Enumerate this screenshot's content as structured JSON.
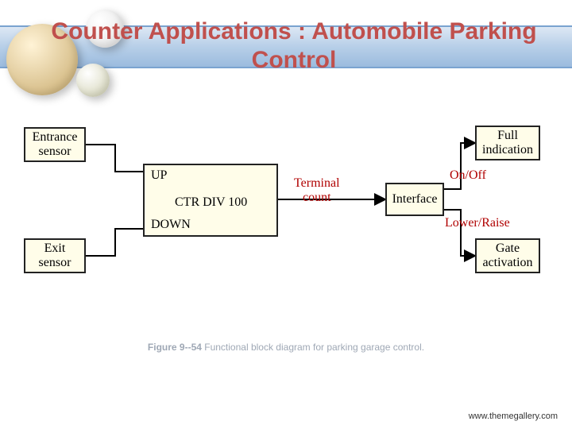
{
  "title": "Counter Applications : Automobile Parking Control",
  "diagram": {
    "blocks": {
      "entrance": "Entrance\nsensor",
      "exit": "Exit\nsensor",
      "counter": {
        "up": "UP",
        "main": "CTR DIV 100",
        "down": "DOWN"
      },
      "terminal": "Terminal\ncount",
      "interface": "Interface",
      "full": "Full\nindication",
      "gate": "Gate\nactivation"
    },
    "signals": {
      "onoff": "On/Off",
      "lowerraise": "Lower/Raise"
    }
  },
  "caption_prefix": "Figure 9--54",
  "caption_rest": "   Functional block diagram for parking garage control.",
  "footer_url": "www.themegallery.com"
}
